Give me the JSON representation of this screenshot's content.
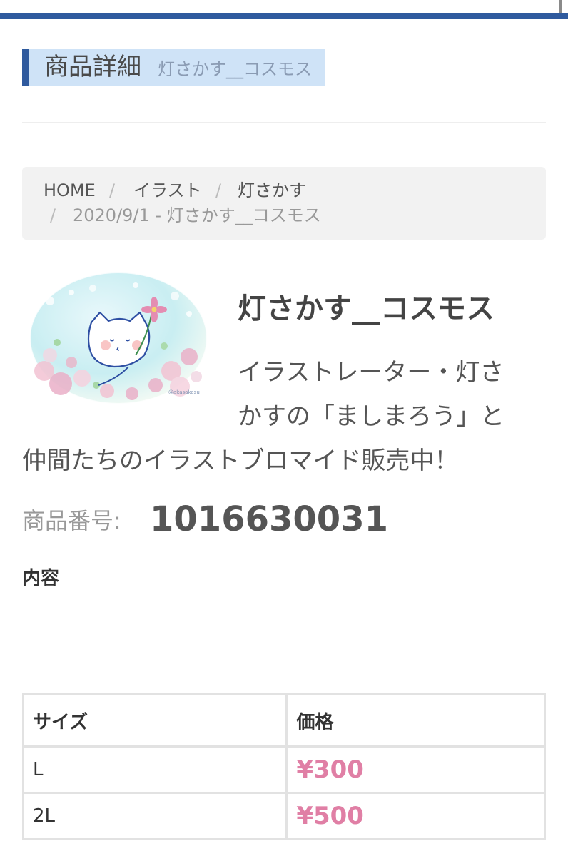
{
  "header": {
    "section_title": "商品詳細",
    "section_subtitle": "灯さかす__コスモス"
  },
  "breadcrumb": {
    "items": [
      "HOME",
      "イラスト",
      "灯さかす"
    ],
    "separator": "/",
    "current": "2020/9/1 - 灯さかす__コスモス"
  },
  "product": {
    "name": "灯さかす__コスモス",
    "description_lines": [
      "イラストレーター・灯さ",
      "かすの「ましまろう」と",
      "仲間たちのイラストブロマイド販売中！"
    ],
    "number_label": "商品番号:",
    "number": "1016630031",
    "content_label": "内容",
    "image_icon": "cat-with-cosmos-illustration"
  },
  "price_table": {
    "headers": [
      "サイズ",
      "価格"
    ],
    "rows": [
      {
        "size": "L",
        "price": "¥300"
      },
      {
        "size": "2L",
        "price": "¥500"
      }
    ]
  },
  "colors": {
    "accent_blue": "#2f5a9e",
    "header_bg": "#cfe3f7",
    "price_pink": "#e07fa5"
  }
}
